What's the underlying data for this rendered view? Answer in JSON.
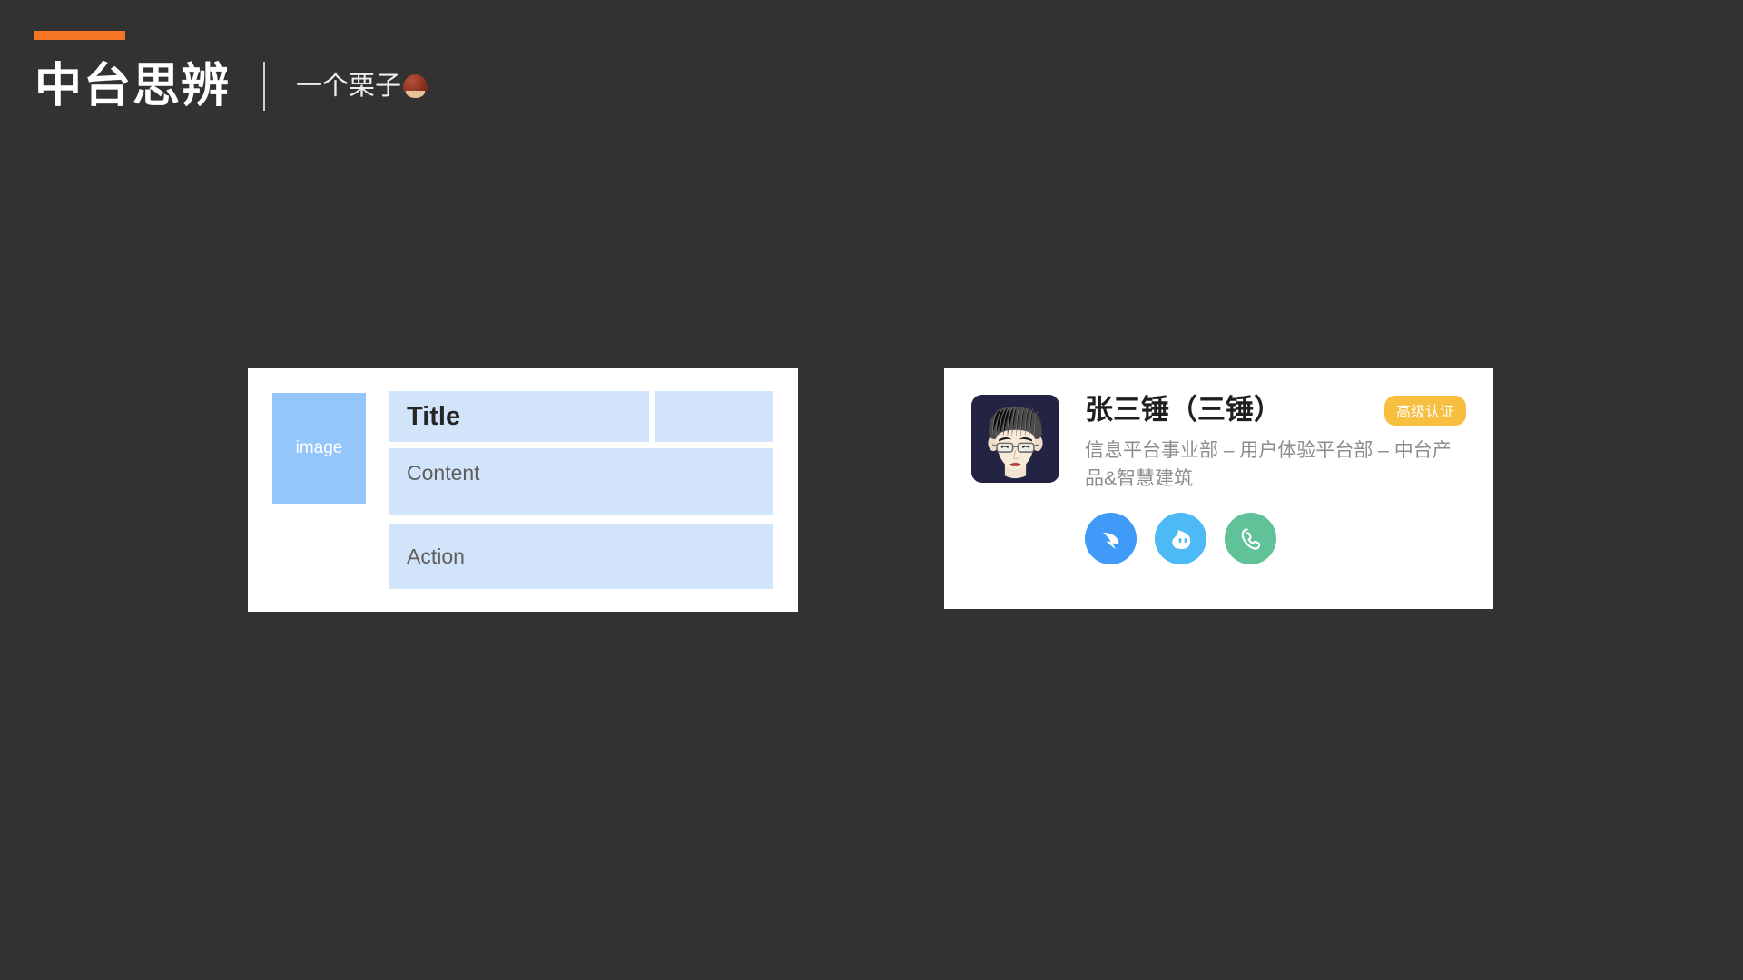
{
  "header": {
    "accent_color": "#f47523",
    "title": "中台思辨",
    "subtitle": "一个栗子",
    "subtitle_emoji_name": "chestnut-emoji"
  },
  "background_color": "#323232",
  "wireframe_card": {
    "image_placeholder_label": "image",
    "image_placeholder_color": "#95c6fb",
    "block_color": "#d2e4fa",
    "title_label": "Title",
    "content_label": "Content",
    "action_label": "Action"
  },
  "profile_card": {
    "avatar_name": "user-avatar",
    "avatar_background": "#232344",
    "name": "张三锤（三锤）",
    "badge": {
      "label": "高级认证",
      "color": "#f7bf3f"
    },
    "department": "信息平台事业部 – 用户体验平台部 – 中台产品&智慧建筑",
    "actions": [
      {
        "name": "dingtalk-icon",
        "label": "钉钉",
        "color": "#3f9bf7"
      },
      {
        "name": "wangwang-icon",
        "label": "旺旺",
        "color": "#4dbaf5"
      },
      {
        "name": "phone-icon",
        "label": "电话",
        "color": "#61c198"
      }
    ]
  }
}
